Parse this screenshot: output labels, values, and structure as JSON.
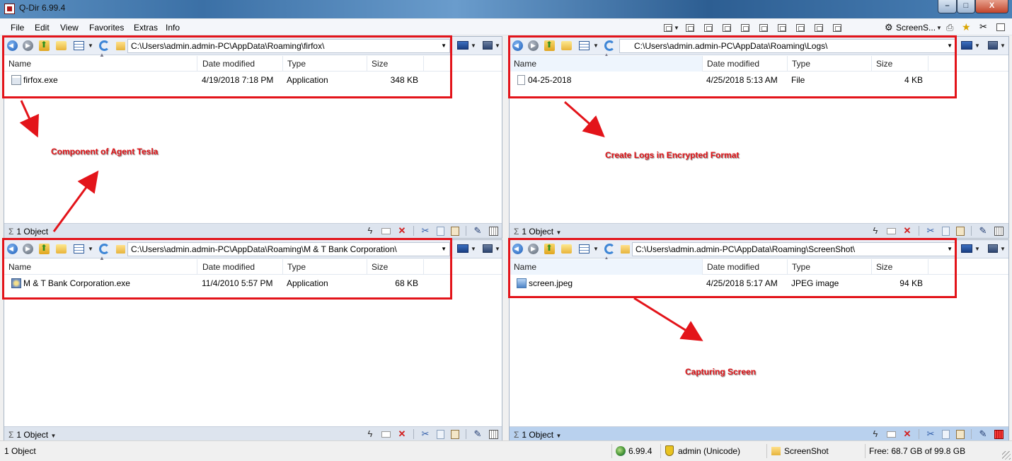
{
  "window": {
    "title": "Q-Dir 6.99.4",
    "minimize_glyph": "–",
    "maximize_glyph": "□",
    "close_glyph": "X"
  },
  "menu": {
    "items": [
      "File",
      "Edit",
      "View",
      "Favorites",
      "Extras",
      "Info"
    ],
    "screens_label": "ScreenS..."
  },
  "columns": {
    "name": "Name",
    "date": "Date modified",
    "type": "Type",
    "size": "Size"
  },
  "panes": {
    "top_left": {
      "path": "C:\\Users\\admin.admin-PC\\AppData\\Roaming\\firfox\\",
      "file": {
        "name": "firfox.exe",
        "date": "4/19/2018 7:18 PM",
        "type": "Application",
        "size": "348 KB",
        "icon": "application-icon"
      },
      "status": "1 Object"
    },
    "top_right": {
      "path": "C:\\Users\\admin.admin-PC\\AppData\\Roaming\\Logs\\",
      "file": {
        "name": "04-25-2018",
        "date": "4/25/2018 5:13 AM",
        "type": "File",
        "size": "4 KB",
        "icon": "file-icon"
      },
      "status": "1 Object"
    },
    "bottom_left": {
      "path": "C:\\Users\\admin.admin-PC\\AppData\\Roaming\\M & T Bank Corporation\\",
      "file": {
        "name": "M & T Bank Corporation.exe",
        "date": "11/4/2010 5:57 PM",
        "type": "Application",
        "size": "68 KB",
        "icon": "bank-exe-icon"
      },
      "status": "1 Object"
    },
    "bottom_right": {
      "path": "C:\\Users\\admin.admin-PC\\AppData\\Roaming\\ScreenShot\\",
      "file": {
        "name": "screen.jpeg",
        "date": "4/25/2018 5:17 AM",
        "type": "JPEG image",
        "size": "94 KB",
        "icon": "jpeg-image-icon"
      },
      "status": "1 Object"
    }
  },
  "annotations": {
    "component": "Component of Agent Tesla",
    "logs": "Create Logs in Encrypted Format",
    "capture": "Capturing Screen",
    "color": "#e3141a"
  },
  "statusbar": {
    "objects": "1 Object",
    "version": "6.99.4",
    "user": "admin (Unicode)",
    "folder": "ScreenShot",
    "free": "Free: 68.7 GB of 99.8 GB"
  }
}
